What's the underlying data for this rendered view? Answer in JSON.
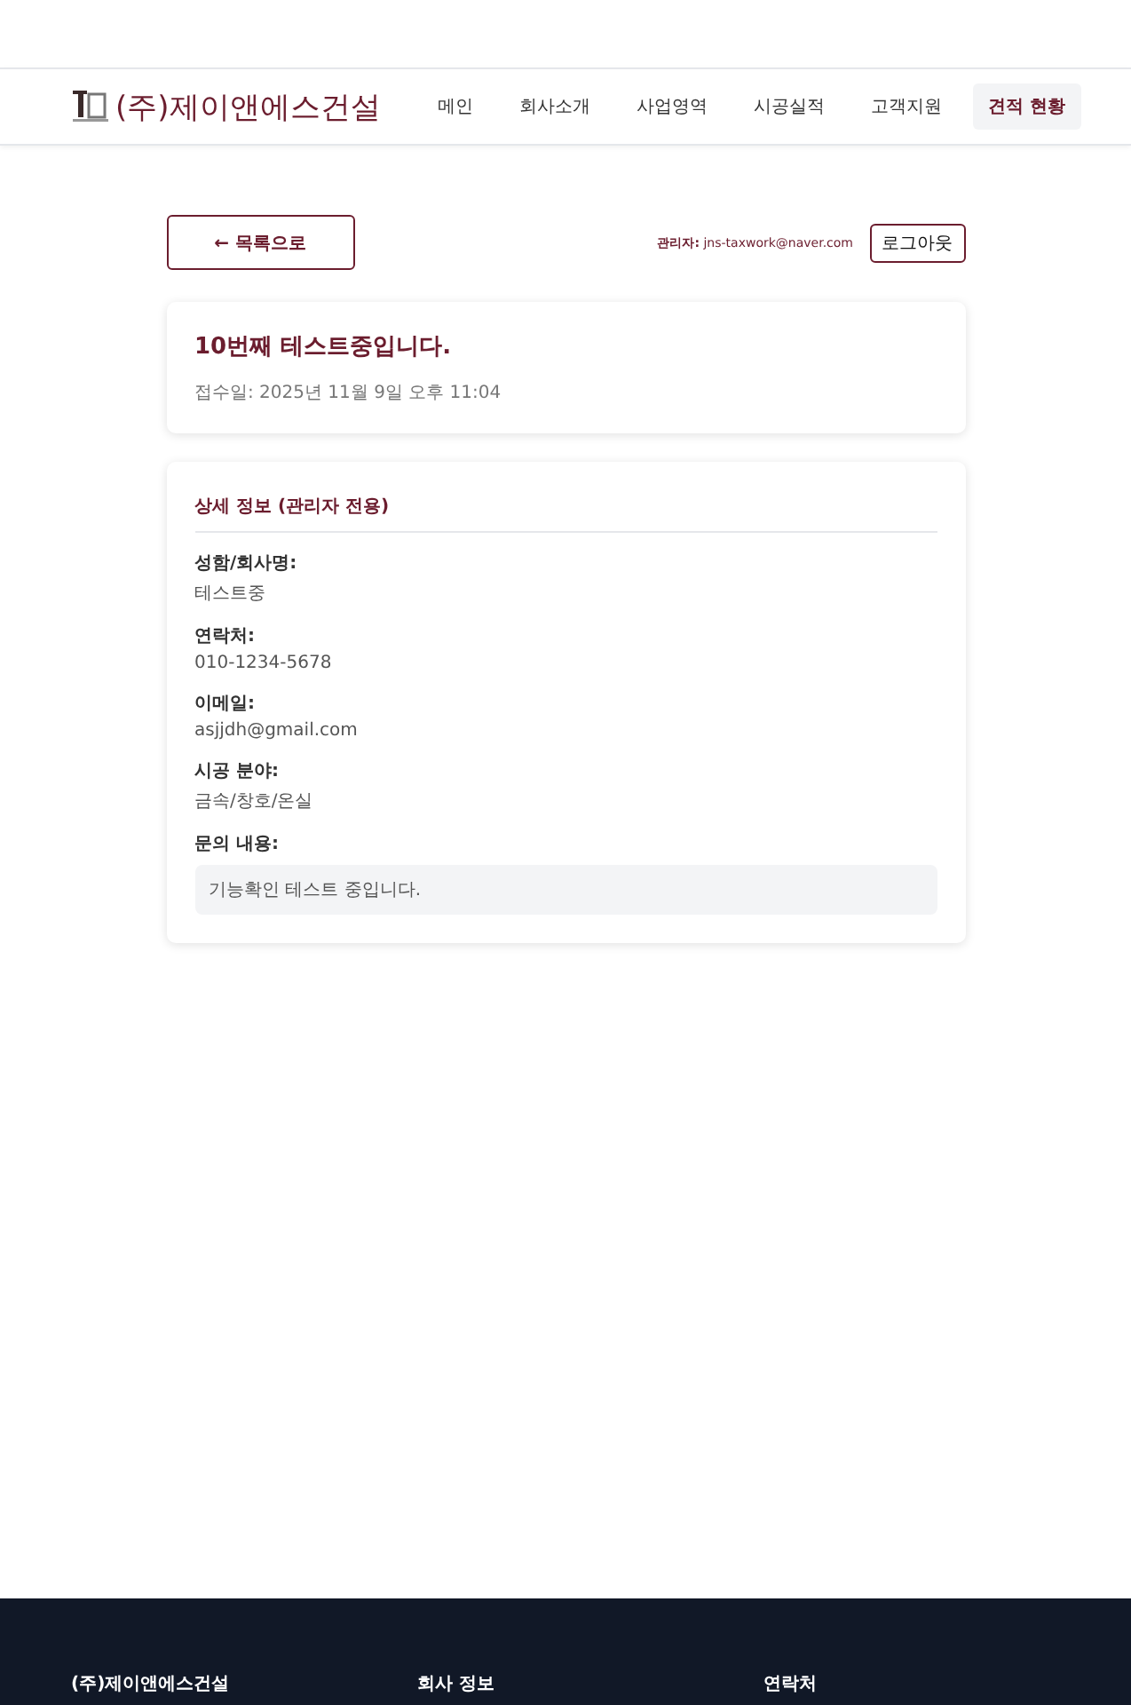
{
  "header": {
    "brand": "(주)제이앤에스건설",
    "nav": [
      {
        "label": "메인",
        "selected": false
      },
      {
        "label": "회사소개",
        "selected": false
      },
      {
        "label": "사업영역",
        "selected": false
      },
      {
        "label": "시공실적",
        "selected": false
      },
      {
        "label": "고객지원",
        "selected": false
      },
      {
        "label": "견적 현황",
        "selected": true
      }
    ]
  },
  "toolbar": {
    "back_button": "← 목록으로",
    "admin_label": "관리자:",
    "admin_email": "jns-taxwork@naver.com",
    "logout_button": "로그아웃"
  },
  "summary": {
    "title": "10번째 테스트중입니다.",
    "received": "접수일: 2025년 11월 9일 오후 11:04"
  },
  "details": {
    "title": "상세 정보 (관리자 전용)",
    "fields": [
      {
        "kind": "text",
        "label": "성함/회사명:",
        "value": "테스트중"
      },
      {
        "kind": "text",
        "label": "연락처:",
        "value": "010-1234-5678"
      },
      {
        "kind": "text",
        "label": "이메일:",
        "value": "asjjdh@gmail.com"
      },
      {
        "kind": "text",
        "label": "시공 분야:",
        "value": "금속/창호/온실"
      },
      {
        "kind": "message",
        "label": "문의 내용:",
        "value": "기능확인 테스트 중입니다."
      }
    ]
  },
  "footer": {
    "headings": [
      "(주)제이앤에스건설",
      "회사 정보",
      "연락처"
    ]
  }
}
